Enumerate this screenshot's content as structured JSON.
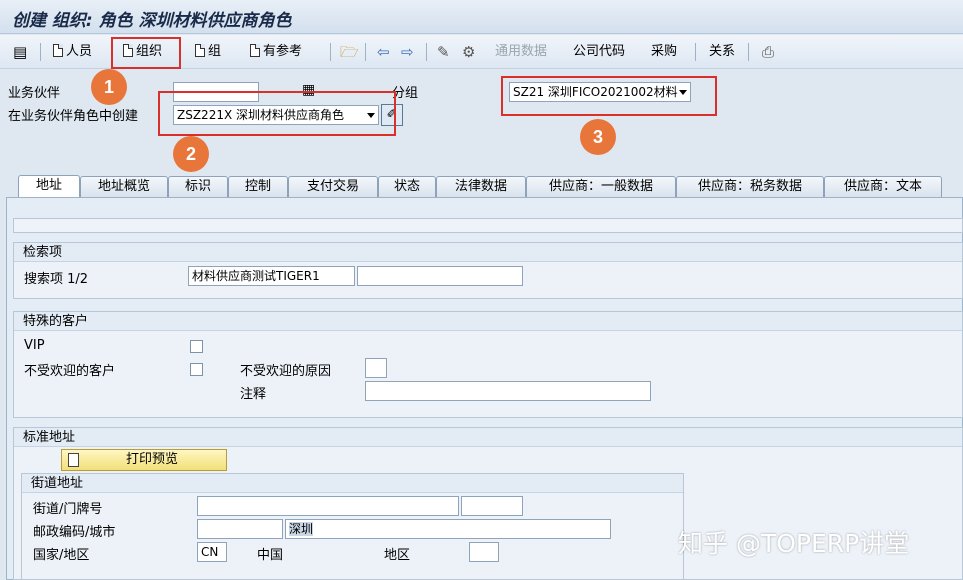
{
  "window": {
    "title": "创建 组织: 角色 深圳材料供应商角色"
  },
  "toolbar": {
    "person_label": "人员",
    "organization_label": "组织",
    "group_label": "组",
    "with_reference_label": "有参考",
    "general_data_label": "通用数据",
    "company_code_label": "公司代码",
    "purchasing_label": "采购",
    "relations_label": "关系"
  },
  "header": {
    "bp_label": "业务伙伴",
    "bp_value": "",
    "grouping_label": "分组",
    "grouping_value": "SZ21 深圳FICO2021002材料",
    "role_label": "在业务伙伴角色中创建",
    "role_value": "ZSZ221X 深圳材料供应商角色"
  },
  "annotations": {
    "one": "1",
    "two": "2",
    "three": "3"
  },
  "tabs": [
    "地址",
    "地址概览",
    "标识",
    "控制",
    "支付交易",
    "状态",
    "法律数据",
    "供应商：一般数据",
    "供应商：税务数据",
    "供应商：文本"
  ],
  "search": {
    "group_title": "检索项",
    "term_label": "搜索项 1/2",
    "term1_value": "材料供应商测试TIGER1",
    "term2_value": ""
  },
  "special_customer": {
    "group_title": "特殊的客户",
    "vip_label": "VIP",
    "unwanted_label": "不受欢迎的客户",
    "reason_label": "不受欢迎的原因",
    "reason_value": "",
    "comment_label": "注释",
    "comment_value": ""
  },
  "standard_address": {
    "group_title": "标准地址",
    "print_preview_label": "打印预览",
    "street_group_title": "街道地址",
    "street_label": "街道/门牌号",
    "street_value": "",
    "house_no_value": "",
    "postal_city_label": "邮政编码/城市",
    "postal_value": "",
    "city_value": "深圳",
    "country_label": "国家/地区",
    "country_code": "CN",
    "country_name": "中国",
    "region_label": "地区",
    "region_value": ""
  },
  "watermark": "知乎 @TOPERP讲堂"
}
